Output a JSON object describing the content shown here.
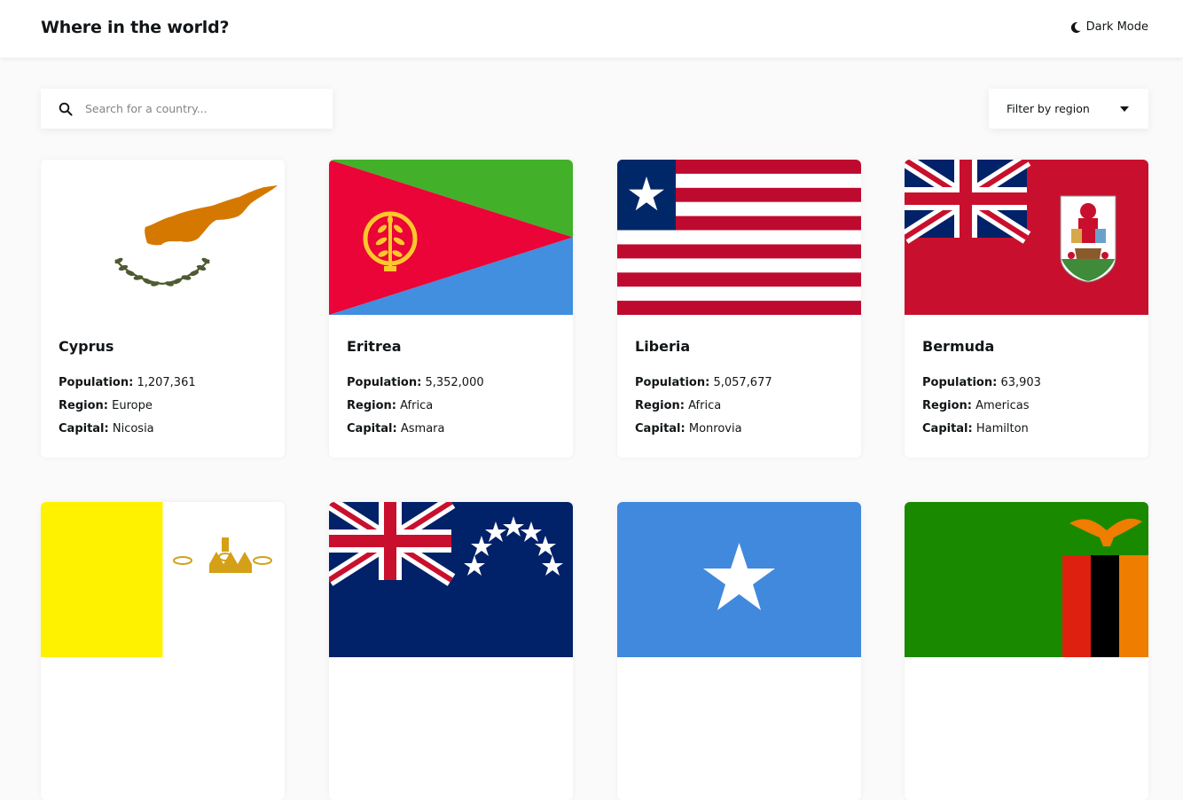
{
  "header": {
    "title": "Where in the world?",
    "theme_toggle_label": "Dark Mode"
  },
  "search": {
    "placeholder": "Search for a country...",
    "value": ""
  },
  "filter": {
    "label": "Filter by region"
  },
  "labels": {
    "population": "Population:",
    "region": "Region:",
    "capital": "Capital:"
  },
  "countries": [
    {
      "name": "Cyprus",
      "population": "1,207,361",
      "region": "Europe",
      "capital": "Nicosia"
    },
    {
      "name": "Eritrea",
      "population": "5,352,000",
      "region": "Africa",
      "capital": "Asmara"
    },
    {
      "name": "Liberia",
      "population": "5,057,677",
      "region": "Africa",
      "capital": "Monrovia"
    },
    {
      "name": "Bermuda",
      "population": "63,903",
      "region": "Americas",
      "capital": "Hamilton"
    }
  ],
  "icons": {
    "theme": "moon-icon",
    "search": "search-icon",
    "filter": "caret-down-icon"
  },
  "colors": {
    "background": "#fafafa",
    "element": "#ffffff",
    "text": "#111517",
    "placeholder": "#858585"
  }
}
